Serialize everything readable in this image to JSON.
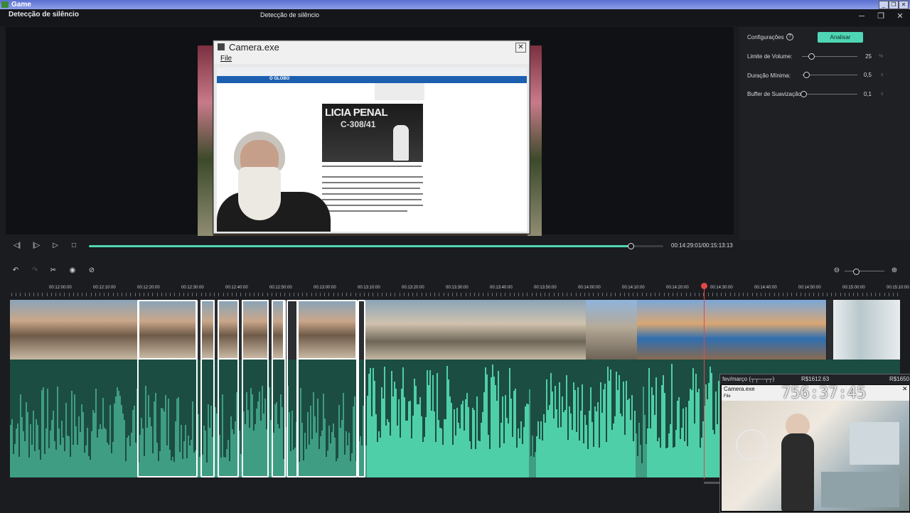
{
  "os": {
    "title": "Game"
  },
  "app": {
    "header_left": "Detecção de silêncio",
    "header_center": "Detecção de silêncio"
  },
  "camera_window": {
    "title": "Camera.exe",
    "menu_file": "File",
    "news_headline": "LICIA PENAL",
    "news_sub": "C-308/41",
    "site_name": "O GLOBO"
  },
  "settings": {
    "label": "Configurações",
    "analyze_button": "Analisar",
    "sliders": [
      {
        "label": "Limite de Volume:",
        "value": "25",
        "unit": "%",
        "level": 0.17
      },
      {
        "label": "Duração Mínima:",
        "value": "0,5",
        "unit": "s",
        "level": 0.08
      },
      {
        "label": "Buffer de Suavização:",
        "value": "0,1",
        "unit": "s",
        "level": 0.02
      }
    ]
  },
  "player": {
    "timecode": "00:14:29:01/00:15:13:13",
    "progress": 0.943
  },
  "timeline": {
    "ruler_labels": [
      "00:12:00:00",
      "00:12:10:00",
      "00:12:20:00",
      "00:12:30:00",
      "00:12:40:00",
      "00:12:50:00",
      "00:13:00:00",
      "00:13:10:00",
      "00:13:20:00",
      "00:13:30:00",
      "00:13:40:00",
      "00:13:50:00",
      "00:14:00:00",
      "00:14:10:00",
      "00:14:20:00",
      "00:14:30:00",
      "00:14:40:00",
      "00:14:50:00",
      "00:15:00:00",
      "00:15:10:00"
    ]
  },
  "overlay": {
    "head_left": "fev/março (┬┬—┬┬)",
    "head_mid": "R$1612.63",
    "head_right": "R$1650",
    "cam_title": "Camera.exe",
    "file": "File",
    "timer": "756:37:45"
  },
  "colors": {
    "accent": "#4fd6b4",
    "playhead": "#e04848",
    "audio": "#4fcfa8"
  }
}
